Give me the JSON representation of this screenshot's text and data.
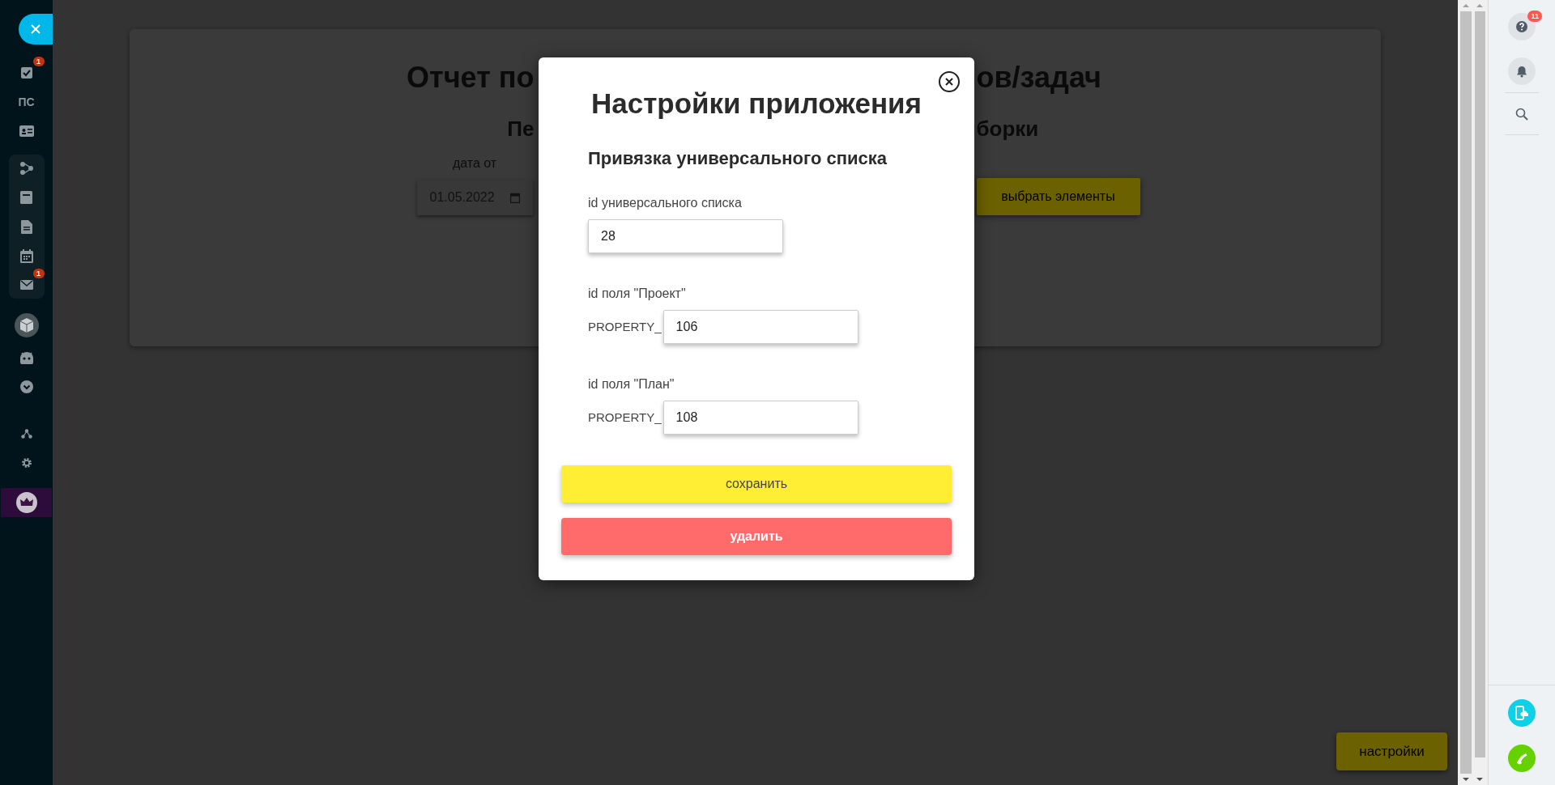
{
  "sidebar": {
    "items": [
      {
        "kind": "close"
      },
      {
        "kind": "tasks",
        "badge": "1"
      },
      {
        "kind": "text",
        "label": "ПС"
      },
      {
        "kind": "contact"
      },
      {
        "kind": "group",
        "children": [
          {
            "kind": "flow"
          },
          {
            "kind": "card"
          },
          {
            "kind": "document"
          },
          {
            "kind": "calendar"
          },
          {
            "kind": "mail",
            "badge": "1"
          }
        ]
      },
      {
        "kind": "cube"
      },
      {
        "kind": "robot"
      },
      {
        "kind": "more"
      },
      {
        "kind": "network"
      },
      {
        "kind": "settings"
      },
      {
        "kind": "crown"
      }
    ]
  },
  "report": {
    "title_left": "Отчет по",
    "title_right": "ов/задач",
    "subtitle_left": "Пе",
    "subtitle_right": "борки",
    "date_label": "дата от",
    "date_value": "01.05.2022",
    "select_button": "выбрать элементы"
  },
  "settings_button": "настройки",
  "modal": {
    "title": "Настройки приложения",
    "section_title": "Привязка универсального списка",
    "fields": [
      {
        "kind": "plain",
        "label": "id универсального списка",
        "value": "28"
      },
      {
        "kind": "prefixed",
        "label": "id поля \"Проект\"",
        "prefix": "PROPERTY_",
        "value": "106"
      },
      {
        "kind": "prefixed",
        "label": "id поля \"План\"",
        "prefix": "PROPERTY_",
        "value": "108"
      }
    ],
    "buttons": [
      {
        "kind": "save",
        "label": "сохранить"
      },
      {
        "kind": "delete",
        "label": "удалить"
      }
    ]
  },
  "right_panel": {
    "top": [
      {
        "kind": "help",
        "badge": "11"
      },
      {
        "kind": "bell"
      },
      {
        "kind": "search"
      }
    ],
    "bottom": [
      {
        "kind": "phone-cloud"
      },
      {
        "kind": "call"
      }
    ]
  }
}
